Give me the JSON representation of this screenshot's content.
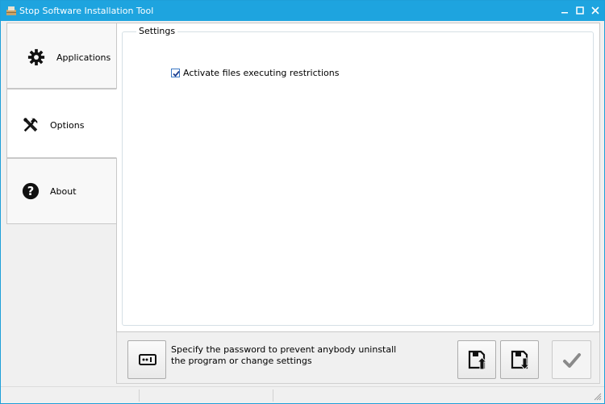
{
  "window": {
    "title": "Stop Software Installation Tool",
    "title_bar_color": "#1ea4df",
    "controls": {
      "minimize": "‒",
      "maximize": "☐",
      "close": "✕"
    }
  },
  "nav": {
    "items": [
      {
        "label": "Applications",
        "icon": "gear-icon",
        "active": false
      },
      {
        "label": "Options",
        "icon": "tools-icon",
        "active": true
      },
      {
        "label": "About",
        "icon": "question-icon",
        "active": false
      }
    ]
  },
  "settings": {
    "group_title": "Settings",
    "checkbox_label": "Activate files executing restrictions",
    "checkbox_checked": true
  },
  "bottom": {
    "hint_line1": "Specify the password to prevent anybody uninstall",
    "hint_line2": "the program or change settings",
    "buttons": {
      "password": "password-icon",
      "export": "save-export-icon",
      "import": "save-import-icon",
      "apply": "checkmark-icon"
    }
  }
}
